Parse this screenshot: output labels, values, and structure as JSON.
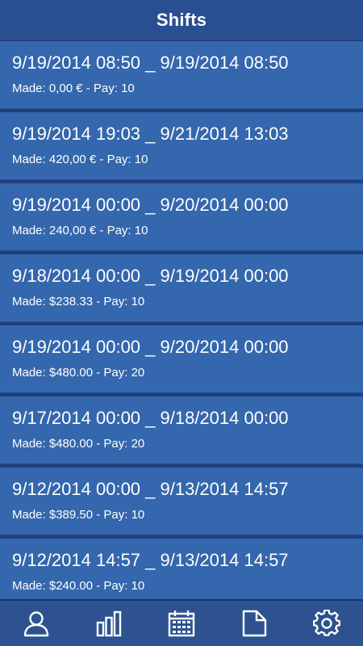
{
  "header": {
    "title": "Shifts"
  },
  "shifts": [
    {
      "range": "9/19/2014 08:50 _ 9/19/2014 08:50",
      "meta": "Made: 0,00 € - Pay: 10"
    },
    {
      "range": "9/19/2014 19:03 _ 9/21/2014 13:03",
      "meta": "Made: 420,00 € - Pay: 10"
    },
    {
      "range": "9/19/2014 00:00 _ 9/20/2014 00:00",
      "meta": "Made: 240,00 € - Pay: 10"
    },
    {
      "range": "9/18/2014 00:00 _ 9/19/2014 00:00",
      "meta": "Made: $238.33 - Pay: 10"
    },
    {
      "range": "9/19/2014 00:00 _ 9/20/2014 00:00",
      "meta": "Made: $480.00 - Pay: 20"
    },
    {
      "range": "9/17/2014 00:00 _ 9/18/2014 00:00",
      "meta": "Made: $480.00 - Pay: 20"
    },
    {
      "range": "9/12/2014 00:00 _ 9/13/2014 14:57",
      "meta": "Made: $389.50 - Pay: 10"
    },
    {
      "range": "9/12/2014 14:57 _ 9/13/2014 14:57",
      "meta": "Made: $240.00 - Pay: 10"
    }
  ],
  "tabbar": {
    "icons": [
      "person-icon",
      "bar-chart-icon",
      "calendar-icon",
      "document-icon",
      "gear-icon"
    ]
  }
}
